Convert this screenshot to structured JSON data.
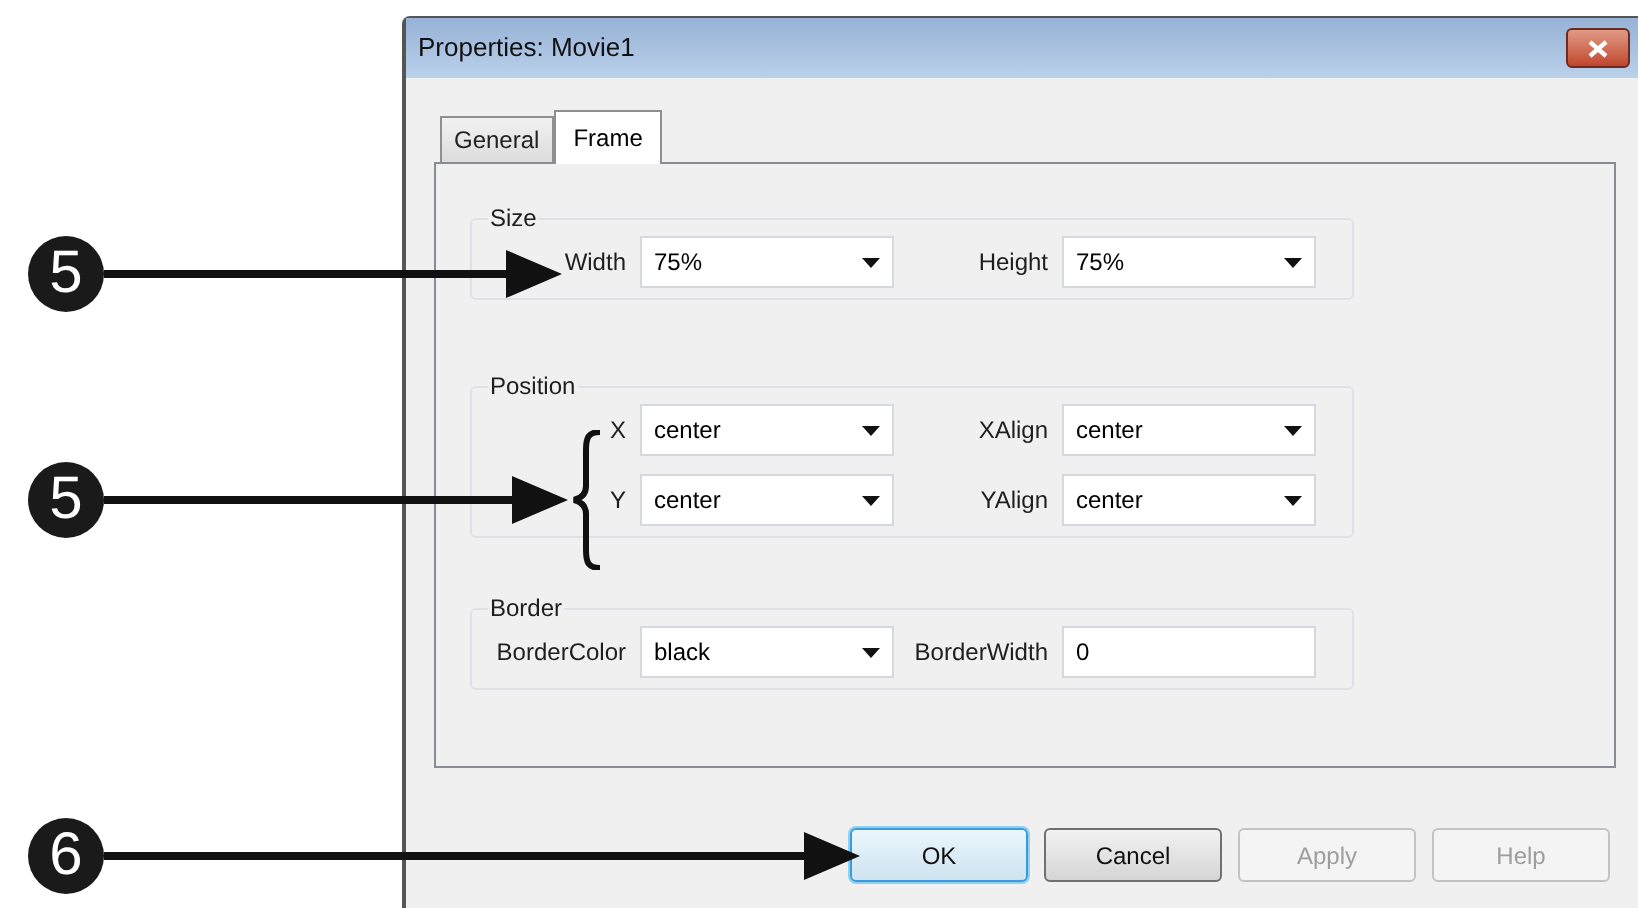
{
  "window": {
    "title": "Properties: Movie1"
  },
  "tabs": [
    {
      "label": "General",
      "selected": false
    },
    {
      "label": "Frame",
      "selected": true
    }
  ],
  "groups": [
    {
      "title": "Size",
      "rows": [
        [
          {
            "label": "Width",
            "value": "75%",
            "kind": "dropdown"
          },
          {
            "label": "Height",
            "value": "75%",
            "kind": "dropdown"
          }
        ]
      ]
    },
    {
      "title": "Position",
      "rows": [
        [
          {
            "label": "X",
            "value": "center",
            "kind": "dropdown"
          },
          {
            "label": "XAlign",
            "value": "center",
            "kind": "dropdown"
          }
        ],
        [
          {
            "label": "Y",
            "value": "center",
            "kind": "dropdown"
          },
          {
            "label": "YAlign",
            "value": "center",
            "kind": "dropdown"
          }
        ]
      ]
    },
    {
      "title": "Border",
      "rows": [
        [
          {
            "label": "BorderColor",
            "value": "black",
            "kind": "dropdown"
          },
          {
            "label": "BorderWidth",
            "value": "0",
            "kind": "text"
          }
        ]
      ]
    }
  ],
  "buttons": [
    {
      "label": "OK",
      "default": true,
      "disabled": false
    },
    {
      "label": "Cancel",
      "default": false,
      "disabled": false
    },
    {
      "label": "Apply",
      "default": false,
      "disabled": true
    },
    {
      "label": "Help",
      "default": false,
      "disabled": true
    }
  ],
  "callouts": [
    {
      "number": "5",
      "kind": "arrow"
    },
    {
      "number": "5",
      "kind": "brace"
    },
    {
      "number": "6",
      "kind": "arrow"
    }
  ]
}
